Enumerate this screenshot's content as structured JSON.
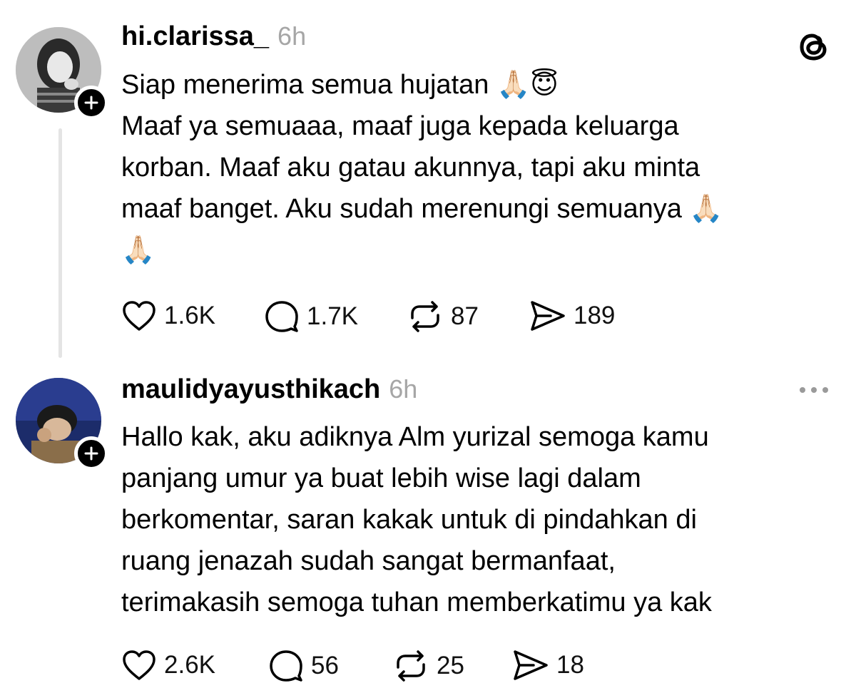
{
  "posts": [
    {
      "username": "hi.clarissa_",
      "time": "6h",
      "lines": [
        "Siap menerima semua hujatan 🙏🏻😇",
        "Maaf ya semuaaa, maaf juga kepada keluarga",
        "korban. Maaf aku gatau akunnya, tapi aku minta",
        "maaf banget. Aku sudah merenungi semuanya 🙏🏻",
        "🙏🏻"
      ],
      "likes": "1.6K",
      "replies": "1.7K",
      "reposts": "87",
      "shares": "189"
    },
    {
      "username": "maulidyayusthikach",
      "time": "6h",
      "lines": [
        "Hallo kak, aku adiknya Alm yurizal semoga kamu",
        "panjang umur ya buat lebih wise lagi dalam",
        "berkomentar, saran kakak untuk di pindahkan di",
        "ruang jenazah sudah sangat bermanfaat,",
        "terimakasih semoga tuhan memberkatimu ya kak"
      ],
      "likes": "2.6K",
      "replies": "56",
      "reposts": "25",
      "shares": "18"
    }
  ],
  "icons": {
    "app_logo": "threads-logo-icon",
    "like": "heart-icon",
    "reply": "comment-icon",
    "repost": "repost-icon",
    "share": "send-icon",
    "more": "more-options-icon",
    "follow": "plus-icon"
  },
  "colors": {
    "text": "#000000",
    "muted": "#a6a6a6",
    "thread_line": "#e4e4e4",
    "background": "#ffffff"
  }
}
